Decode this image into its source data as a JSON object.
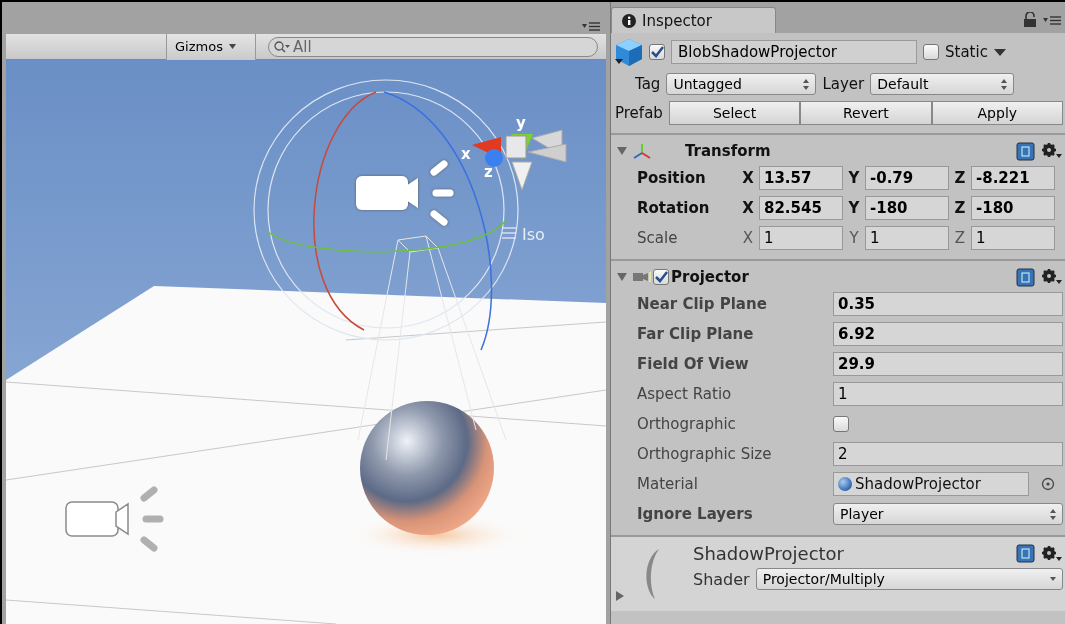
{
  "scene": {
    "gizmos_label": "Gizmos",
    "search_placeholder": "All",
    "axis_labels": [
      {
        "kind": "y",
        "text": "y"
      },
      {
        "kind": "x",
        "text": "x"
      },
      {
        "kind": "z",
        "text": "z"
      }
    ],
    "projection_label": "Iso"
  },
  "inspector": {
    "tab": "Inspector",
    "object": {
      "active": true,
      "name": "BlobShadowProjector",
      "static_label": "Static",
      "static": false,
      "tag_label": "Tag",
      "tag": "Untagged",
      "layer_label": "Layer",
      "layer": "Default",
      "prefab_label": "Prefab",
      "prefab_buttons": [
        "Select",
        "Revert",
        "Apply"
      ]
    },
    "transform": {
      "title": "Transform",
      "expanded": true,
      "rows": [
        {
          "label": "Position",
          "overridden": true,
          "fields": [
            {
              "axis": "X",
              "value": "13.57"
            },
            {
              "axis": "Y",
              "value": "-0.79"
            },
            {
              "axis": "Z",
              "value": "-8.221"
            }
          ]
        },
        {
          "label": "Rotation",
          "overridden": true,
          "fields": [
            {
              "axis": "X",
              "value": "82.545"
            },
            {
              "axis": "Y",
              "value": "-180"
            },
            {
              "axis": "Z",
              "value": "-180"
            }
          ]
        },
        {
          "label": "Scale",
          "overridden": false,
          "fields": [
            {
              "axis": "X",
              "value": "1"
            },
            {
              "axis": "Y",
              "value": "1"
            },
            {
              "axis": "Z",
              "value": "1"
            }
          ]
        }
      ]
    },
    "projector": {
      "title": "Projector",
      "expanded": true,
      "enabled": true,
      "properties": [
        {
          "label": "Near Clip Plane",
          "overridden": true,
          "kind": "number",
          "value": "0.35"
        },
        {
          "label": "Far Clip Plane",
          "overridden": true,
          "kind": "number",
          "value": "6.92"
        },
        {
          "label": "Field Of View",
          "overridden": true,
          "kind": "number",
          "value": "29.9"
        },
        {
          "label": "Aspect Ratio",
          "overridden": false,
          "kind": "number",
          "value": "1"
        },
        {
          "label": "Orthographic",
          "overridden": false,
          "kind": "checkbox",
          "checked": false
        },
        {
          "label": "Orthographic Size",
          "overridden": false,
          "kind": "number",
          "value": "2"
        },
        {
          "label": "Material",
          "overridden": false,
          "kind": "object",
          "value": "ShadowProjector"
        },
        {
          "label": "Ignore Layers",
          "overridden": true,
          "kind": "dropdown",
          "value": "Player"
        }
      ]
    },
    "material": {
      "name": "ShadowProjector",
      "expanded": false,
      "shader_label": "Shader",
      "shader": "Projector/Multiply"
    }
  }
}
